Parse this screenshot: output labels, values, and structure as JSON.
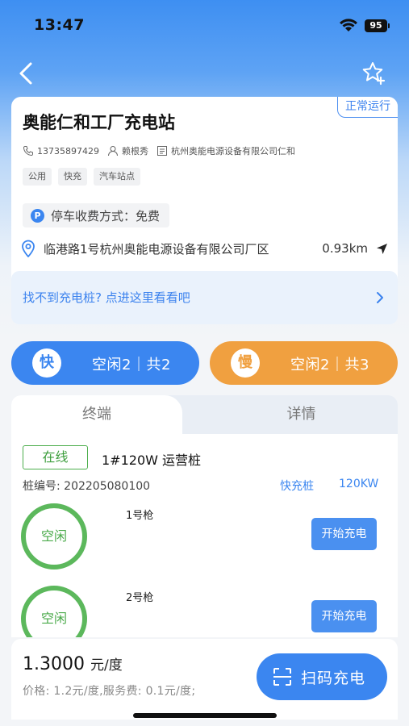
{
  "status_bar": {
    "time": "13:47",
    "battery": "95"
  },
  "header": {
    "back_icon": "chevron-left-icon",
    "favorite_icon": "star-add-icon"
  },
  "station": {
    "name": "奥能仁和工厂充电站",
    "status": "正常运行",
    "phone": "13735897429",
    "contact": "赖根秀",
    "company": "杭州奥能电源设备有限公司仁和",
    "tags": [
      "公用",
      "快充",
      "汽车站点"
    ],
    "parking_fee": "停车收费方式：免费",
    "address": "临港路1号杭州奥能电源设备有限公司厂区",
    "distance": "0.93km"
  },
  "help": {
    "text": "找不到充电桩? 点进这里看看吧"
  },
  "summary": {
    "fast": {
      "icon_label": "快",
      "status": "空闲2｜共2"
    },
    "slow": {
      "icon_label": "慢",
      "status": "空闲2｜共3"
    }
  },
  "tabs": [
    "终端",
    "详情"
  ],
  "terminal": {
    "online": "在线",
    "name": "1#120W 运营桩",
    "code": "桩编号:  202205080100",
    "type": "快充桩",
    "power": "120KW",
    "guns": [
      {
        "label": "1号枪",
        "status": "空闲",
        "action": "开始充电"
      },
      {
        "label": "2号枪",
        "status": "空闲",
        "action": "开始充电"
      }
    ]
  },
  "bottom": {
    "price": "1.3000",
    "price_unit": "元/度",
    "price_detail": "价格:  1.2元/度,服务费:  0.1元/度;",
    "scan_label": "扫码充电"
  },
  "colors": {
    "primary": "#3b86f0",
    "slow": "#f0a040",
    "online": "#4cae4c"
  }
}
